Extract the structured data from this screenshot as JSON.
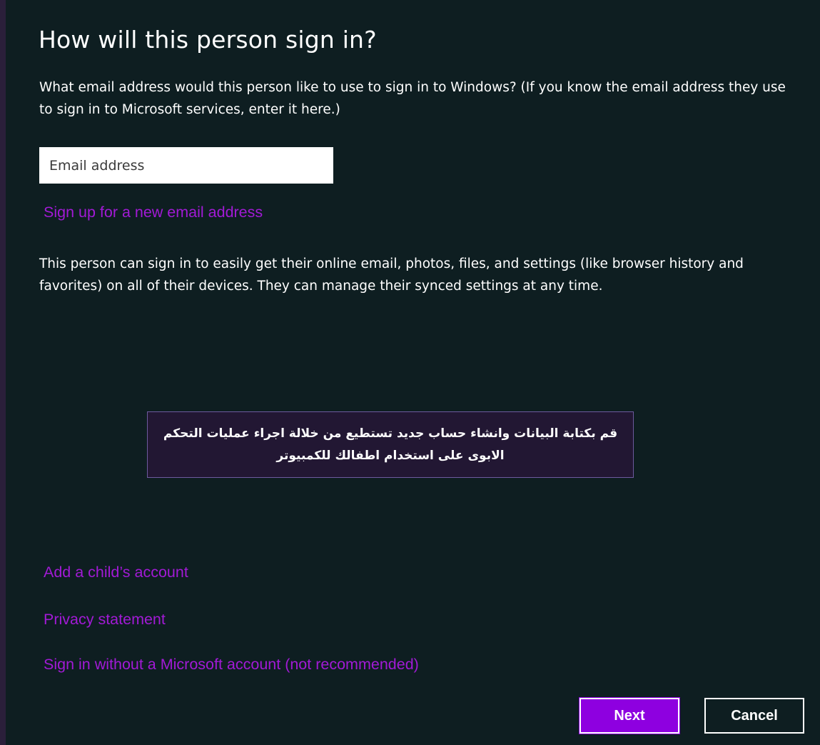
{
  "dialog": {
    "title": "How will this person sign in?",
    "description": "What email address would this person like to use to sign in to Windows? (If you know the email address they use to sign in to Microsoft services, enter it here.)",
    "email_input": {
      "value": "",
      "placeholder": "Email address"
    },
    "signup_link": "Sign up for a new email address",
    "info_text": "This person can sign in to easily get their online email, photos, files, and settings (like browser history and favorites) on all of their devices. They can manage their synced settings at any time.",
    "links": {
      "child_account": "Add a child’s account",
      "privacy": "Privacy statement",
      "no_microsoft_account": "Sign in without a Microsoft account (not recommended)"
    },
    "buttons": {
      "next": "Next",
      "cancel": "Cancel"
    }
  },
  "annotation": {
    "text": "قم بكتابة البيانات وانشاء حساب جديد تستطيع من خلالة اجراء عمليات التحكم الابوى على استخدام اطفالك للكمبيوتر"
  },
  "colors": {
    "background": "#0e1e21",
    "link": "#a21ad6",
    "accent_button": "#8e00e0",
    "annotation_background": "#221733",
    "annotation_border": "#6d5a9e"
  }
}
